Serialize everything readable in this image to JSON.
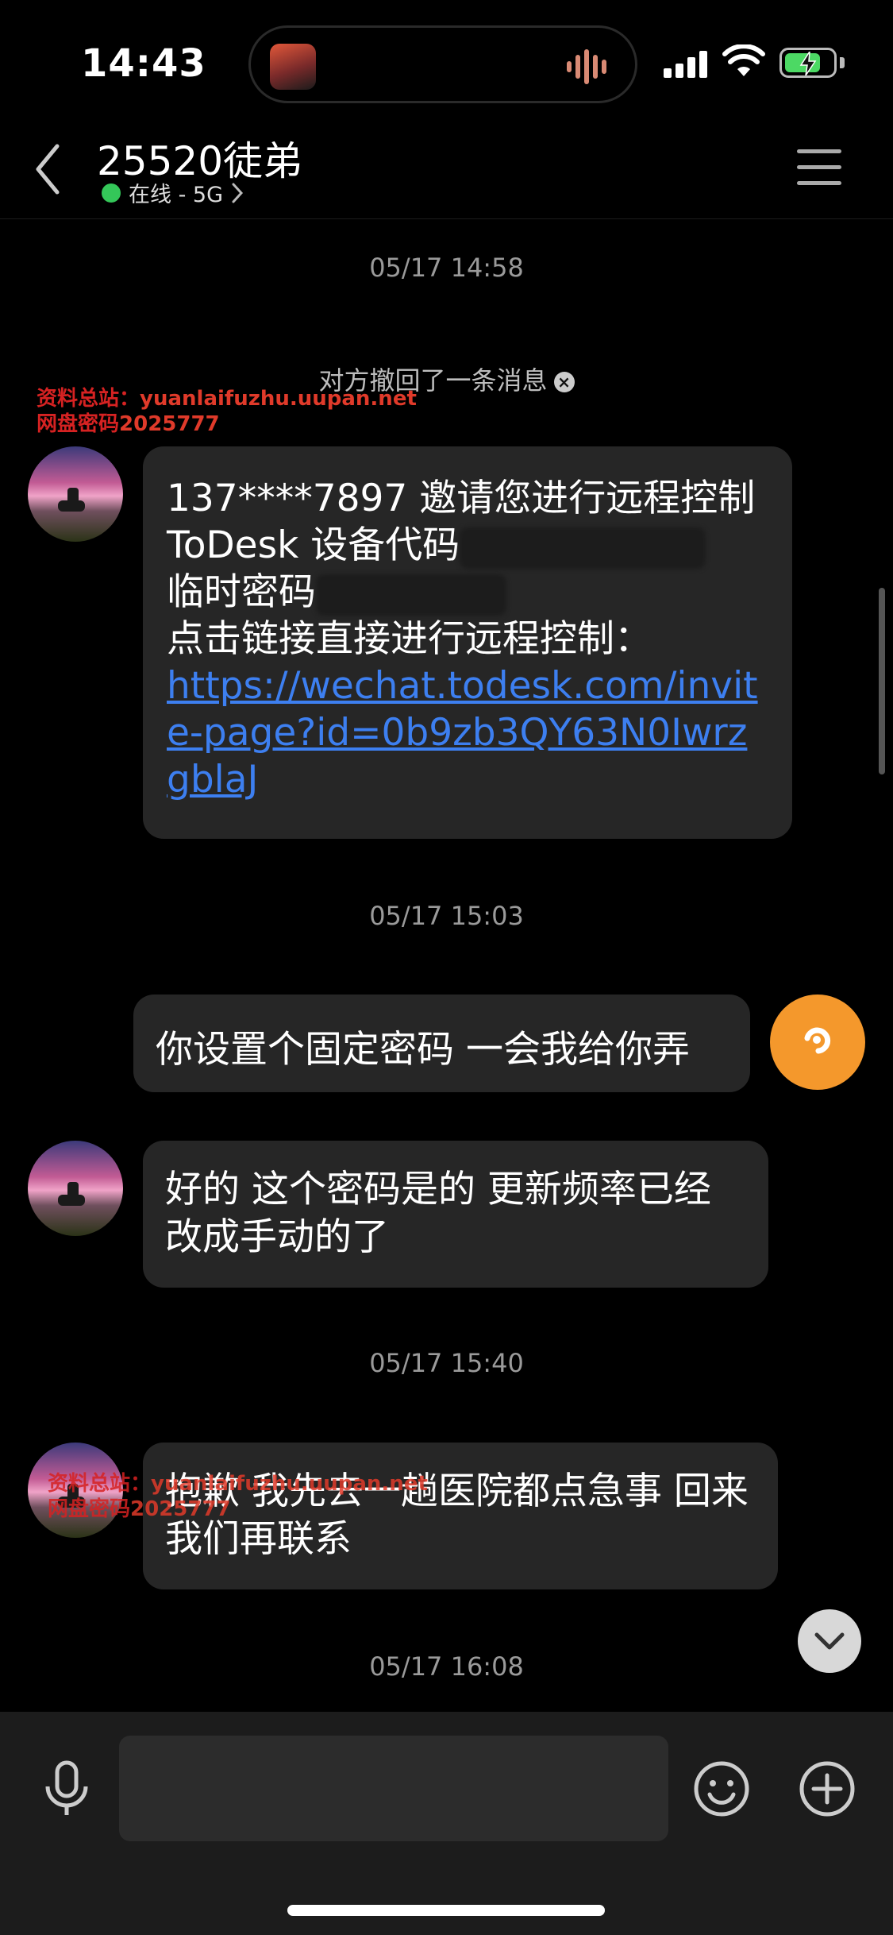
{
  "status": {
    "time": "14:43"
  },
  "header": {
    "title": "25520徒弟",
    "status_text": "在线 - 5G",
    "status_color": "#34c759"
  },
  "watermark": {
    "line1_prefix": "资料总站：",
    "line1_url": "yuanlaifuzhu.uupan.net",
    "line2_prefix": "网盘密码",
    "line2_code": "2025777"
  },
  "messages": {
    "ts1": "05/17 14:58",
    "recall": "对方撤回了一条消息",
    "m1_line1": "137****7897 邀请您进行远程控制",
    "m1_line2": "ToDesk 设备代码",
    "m1_line3": "临时密码",
    "m1_line4": "点击链接直接进行远程控制：",
    "m1_link": "https://wechat.todesk.com/invite-page?id=0b9zb3QY63N0IwrzgblaJ",
    "ts2": "05/17 15:03",
    "m2": "你设置个固定密码 一会我给你弄",
    "m3": "好的 这个密码是的 更新频率已经改成手动的了",
    "ts3": "05/17 15:40",
    "m4": "抱歉 我先去一趟医院都点急事  回来我们再联系",
    "ts4": "05/17 16:08"
  },
  "colors": {
    "accent_avatar": "#f4982c",
    "link": "#3d7ff0"
  },
  "icons": [
    "back-chevron-icon",
    "menu-icon",
    "mic-icon",
    "emoji-icon",
    "plus-icon",
    "chevron-down-icon",
    "wifi-icon",
    "battery-icon",
    "signal-icon"
  ]
}
